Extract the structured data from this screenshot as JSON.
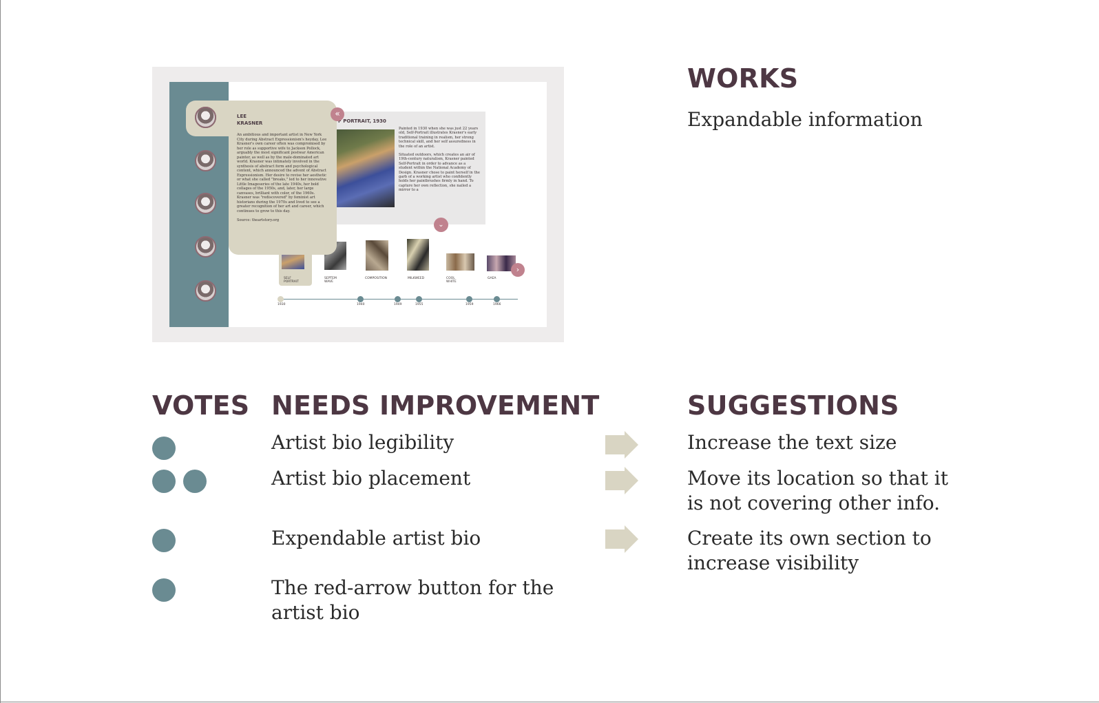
{
  "mockup": {
    "bio": {
      "name_line1": "LEE",
      "name_line2": "KRASNER",
      "text": "An ambitious and important artist in New York City during Abstract Expressionism's heyday, Lee Krasner's own career often was compromised by her role as supportive wife to Jackson Pollock, arguably the most significant postwar American painter, as well as by the male-dominated art world. Krasner was intimately involved in the synthesis of abstract form and psychological content, which announced the advent of Abstract Expressionism. Her desire to revise her aesthetic or what she called \"breaks,\" led to her innovative Little Imageseries of the late 1940s, her bold collages of the 1950s, and, later, her large canvases, brilliant with color, of the 1960s. Krasner was \"rediscovered\" by feminist art historians during the 1970s and lived to see a greater recognition of her art and career, which continues to grow to this day.",
      "source": "Source: theartstory.org",
      "collapse_icon": "«"
    },
    "work": {
      "title": "F PORTRAIT, 1930",
      "paragraph1": "Painted in 1930 when she was just 22 years old, Self-Portrait illustrates Krasner's early traditional training in realism, her strong technical skill, and her self assuredness in the role of an artist.",
      "paragraph2": "Situated outdoors, which creates an air of 19th-century naturalism, Krasner painted Self-Portrait in order to advance as a student within the National Academy of Design. Krasner chose to paint herself in the garb of a working artist who confidently holds her paintbrushes firmly in hand. To capture her own reflection, she nailed a mirror to a",
      "expand_icon": "⌄"
    },
    "thumbnails": [
      {
        "label": "SELF\nPORTRAIT"
      },
      {
        "label": "SEPTEM\nWAVE"
      },
      {
        "label": "COMPOSITION"
      },
      {
        "label": "MILKWEED"
      },
      {
        "label": "COOL\nWHITE"
      },
      {
        "label": "GAEA"
      }
    ],
    "next_icon": "›",
    "timeline_years": [
      "1930",
      "1940",
      "1949",
      "1955",
      "1959",
      "1966"
    ]
  },
  "works": {
    "heading": "WORKS",
    "item": "Expandable information"
  },
  "table": {
    "votes_heading": "VOTES",
    "needs_heading": "NEEDS IMPROVEMENT",
    "suggestions_heading": "SUGGESTIONS",
    "rows": [
      {
        "votes": 1,
        "issue": "Artist bio legibility",
        "suggestion": "Increase the text size"
      },
      {
        "votes": 2,
        "issue": "Artist bio placement",
        "suggestion": "Move its location so that it is not covering other info."
      },
      {
        "votes": 1,
        "issue": "Expendable artist bio",
        "suggestion": "Create its own section to increase visibility"
      },
      {
        "votes": 1,
        "issue": "The red-arrow button for the artist bio",
        "suggestion": ""
      }
    ]
  },
  "colors": {
    "heading": "#4d3743",
    "vote_dot": "#6a8b92",
    "arrow": "#d9d5c3",
    "accent_button": "#c0828e"
  }
}
